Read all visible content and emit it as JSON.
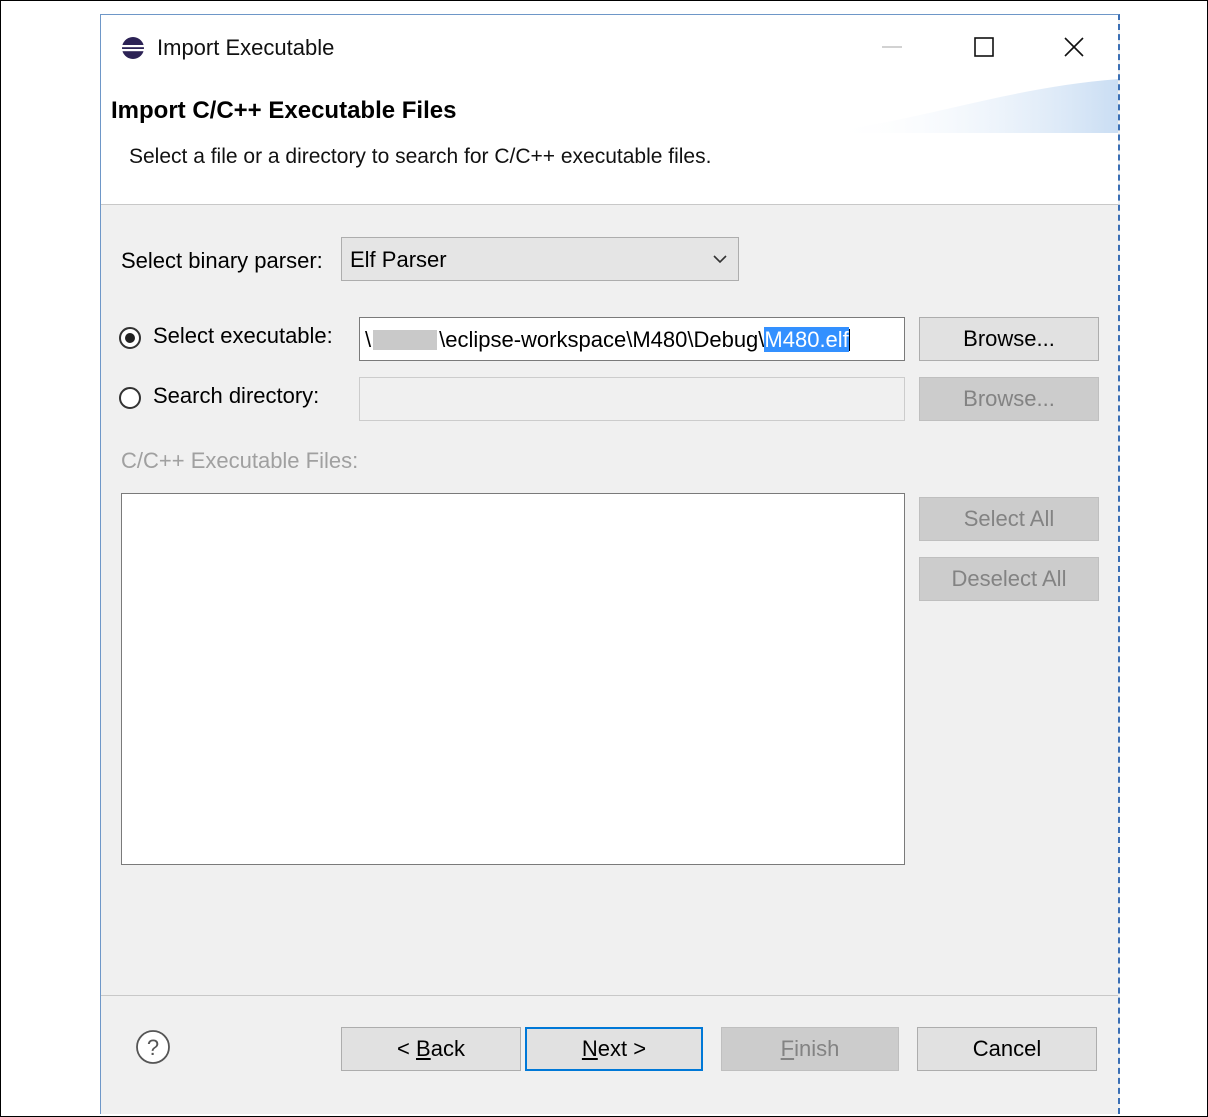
{
  "window": {
    "title": "Import Executable"
  },
  "header": {
    "title": "Import C/C++ Executable Files",
    "description": "Select a file or a directory to search for C/C++ executable files."
  },
  "parser": {
    "label": "Select binary parser:",
    "value": "Elf Parser"
  },
  "executable": {
    "label": "Select executable:",
    "selected": true,
    "path_prefix": "\\",
    "path_middle": "\\eclipse-workspace\\M480\\Debug\\",
    "path_selected": "M480.elf",
    "browse_label": "Browse..."
  },
  "search": {
    "label": "Search directory:",
    "selected": false,
    "value": "",
    "browse_label": "Browse..."
  },
  "files": {
    "label": "C/C++ Executable Files:",
    "items": [],
    "select_all_label": "Select All",
    "deselect_all_label": "Deselect All"
  },
  "footer": {
    "back_label": "< Back",
    "back_mnemonic": "B",
    "next_label": "Next >",
    "next_mnemonic": "N",
    "finish_label": "Finish",
    "finish_mnemonic": "F",
    "cancel_label": "Cancel"
  },
  "icons": {
    "app": "eclipse-icon",
    "help": "help-icon",
    "minimize": "minimize-icon",
    "maximize": "maximize-icon",
    "close": "close-icon",
    "dropdown": "chevron-down-icon"
  },
  "colors": {
    "focus": "#0078d7",
    "selection": "#3390ff"
  }
}
